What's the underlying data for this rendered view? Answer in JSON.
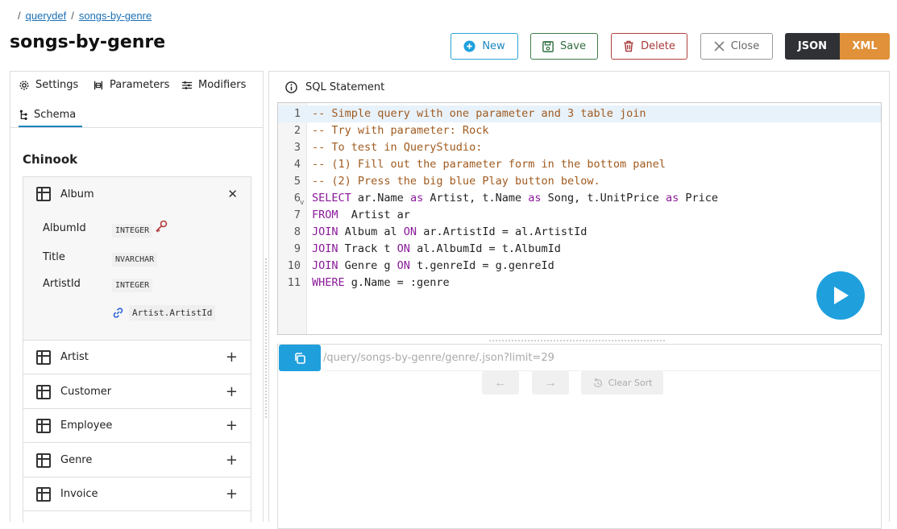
{
  "breadcrumb": {
    "items": [
      "querydef",
      "songs-by-genre"
    ]
  },
  "page": {
    "title": "songs-by-genre"
  },
  "toolbar": {
    "new_label": "New",
    "save_label": "Save",
    "delete_label": "Delete",
    "close_label": "Close",
    "format_json": "JSON",
    "format_xml": "XML",
    "selected_format": "XML"
  },
  "left_tabs": [
    {
      "label": "Settings",
      "icon": "gear-icon"
    },
    {
      "label": "Parameters",
      "icon": "parameters-icon"
    },
    {
      "label": "Modifiers",
      "icon": "sliders-icon"
    },
    {
      "label": "Schema",
      "icon": "schema-icon",
      "active": true
    }
  ],
  "schema": {
    "database": "Chinook",
    "expanded_table": {
      "name": "Album",
      "columns": [
        {
          "name": "AlbumId",
          "type": "INTEGER",
          "primary_key": true
        },
        {
          "name": "Title",
          "type": "NVARCHAR"
        },
        {
          "name": "ArtistId",
          "type": "INTEGER",
          "foreign_key": "Artist.ArtistId"
        }
      ]
    },
    "tables": [
      "Artist",
      "Customer",
      "Employee",
      "Genre",
      "Invoice"
    ]
  },
  "sql": {
    "header": "SQL Statement",
    "lines": [
      "1",
      "2",
      "3",
      "4",
      "5",
      "6",
      "7",
      "8",
      "9",
      "10",
      "11"
    ],
    "code": [
      [
        {
          "c": "cm",
          "t": "-- Simple query with one parameter and 3 table join"
        }
      ],
      [
        {
          "c": "cm",
          "t": "-- Try with parameter: Rock"
        }
      ],
      [
        {
          "c": "cm",
          "t": "-- To test in QueryStudio:"
        }
      ],
      [
        {
          "c": "cm",
          "t": "-- (1) Fill out the parameter form in the bottom panel"
        }
      ],
      [
        {
          "c": "cm",
          "t": "-- (2) Press the big blue Play button below."
        }
      ],
      [
        {
          "c": "kw",
          "t": "SELECT"
        },
        {
          "c": "tx",
          "t": " ar.Name "
        },
        {
          "c": "kw",
          "t": "as"
        },
        {
          "c": "tx",
          "t": " Artist, t.Name "
        },
        {
          "c": "kw",
          "t": "as"
        },
        {
          "c": "tx",
          "t": " Song, t.UnitPrice "
        },
        {
          "c": "kw",
          "t": "as"
        },
        {
          "c": "tx",
          "t": " Price"
        }
      ],
      [
        {
          "c": "kw",
          "t": "FROM"
        },
        {
          "c": "tx",
          "t": "  Artist ar"
        }
      ],
      [
        {
          "c": "kw",
          "t": "JOIN"
        },
        {
          "c": "tx",
          "t": " Album al "
        },
        {
          "c": "kw",
          "t": "ON"
        },
        {
          "c": "tx",
          "t": " ar.ArtistId = al.ArtistId"
        }
      ],
      [
        {
          "c": "kw",
          "t": "JOIN"
        },
        {
          "c": "tx",
          "t": " Track t "
        },
        {
          "c": "kw",
          "t": "ON"
        },
        {
          "c": "tx",
          "t": " al.AlbumId = t.AlbumId"
        }
      ],
      [
        {
          "c": "kw",
          "t": "JOIN"
        },
        {
          "c": "tx",
          "t": " Genre g "
        },
        {
          "c": "kw",
          "t": "ON"
        },
        {
          "c": "tx",
          "t": " t.genreId = g.genreId"
        }
      ],
      [
        {
          "c": "kw",
          "t": "WHERE"
        },
        {
          "c": "tx",
          "t": " g.Name = :genre"
        }
      ]
    ]
  },
  "results": {
    "url": "/query/songs-by-genre/genre/.json?limit=29",
    "prev_label": "←",
    "next_label": "→",
    "clear_sort_label": "Clear Sort"
  },
  "colors": {
    "accent": "#1fa0dd",
    "save": "#3f7a4a",
    "delete": "#b0413e",
    "json_bg": "#2f3135",
    "xml_bg": "#e0913a",
    "comment": "#a05a1e",
    "keyword": "#8a1a9a"
  }
}
